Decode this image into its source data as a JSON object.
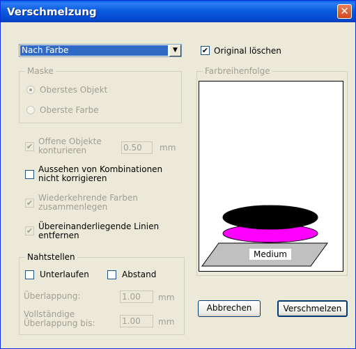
{
  "window": {
    "title": "Verschmelzung",
    "close_label": "✕"
  },
  "mode_select": {
    "value": "Nach Farbe",
    "arrow": "▼"
  },
  "original": {
    "label": "Original löschen",
    "checked": true
  },
  "mask": {
    "title": "Maske",
    "options": [
      "Oberstes Objekt",
      "Oberste Farbe"
    ],
    "selected": 0
  },
  "contour": {
    "label_line1": "Offene Objekte",
    "label_line2": "konturieren",
    "value": "0.50",
    "unit": "mm",
    "checked": true
  },
  "appearance": {
    "label_line1": "Aussehen von Kombinationen",
    "label_line2": "nicht korrigieren",
    "checked": false
  },
  "recurring": {
    "label_line1": "Wiederkehrende Farben",
    "label_line2": "zusammenlegen",
    "checked": true
  },
  "overlap_lines": {
    "label_line1": "Übereinanderliegende Linien",
    "label_line2": "entfernen",
    "checked": true
  },
  "seams": {
    "title": "Nahtstellen",
    "underlay_label": "Unterlaufen",
    "spacing_label": "Abstand",
    "overlap_label": "Überlappung:",
    "overlap_value": "1.00",
    "overlap_unit": "mm",
    "full_overlap_line1": "Vollständige",
    "full_overlap_line2": "Überlappung bis:",
    "full_overlap_value": "1.00",
    "full_overlap_unit": "mm"
  },
  "color_order": {
    "title": "Farbreihenfolge",
    "medium_label": "Medium",
    "colors": {
      "black": "#000000",
      "magenta": "#ff00ff",
      "medium": "#c0c0c0"
    }
  },
  "buttons": {
    "cancel": "Abbrechen",
    "merge": "Verschmelzen"
  }
}
